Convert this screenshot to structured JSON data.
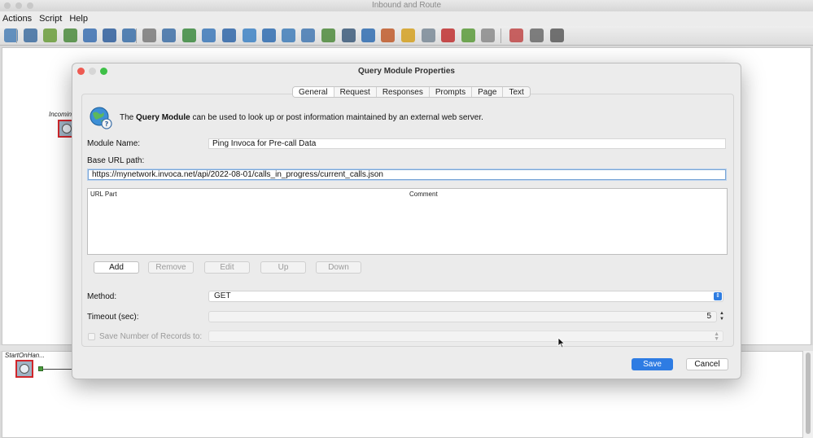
{
  "window": {
    "title": "Inbound and Route"
  },
  "menubar": {
    "items": [
      "Actions",
      "Script",
      "Help"
    ]
  },
  "toolbar": {
    "icons": [
      "script-icon",
      "calculator-grid-icon",
      "edit-check-icon",
      "verify-icon",
      "branch-icon",
      "shuffle-icon",
      "calculator-icon",
      "diamond-icon",
      "user-icon",
      "checklist-icon",
      "globe-icon",
      "database-icon",
      "link-icon",
      "database-query-icon",
      "database-update-icon",
      "table-icon",
      "import-icon",
      "binoculars-icon",
      "screen-icon",
      "users-group-icon",
      "people-icon",
      "agent-icon",
      "tag-icon",
      "download-icon",
      "eraser-icon",
      "person-red-icon",
      "gear-icon",
      "person-gear-icon"
    ]
  },
  "canvas": {
    "incoming_label": "Incomin",
    "start_label": "StartOnHan..."
  },
  "dialog": {
    "title": "Query Module Properties",
    "tabs": [
      "General",
      "Request",
      "Responses",
      "Prompts",
      "Page",
      "Text"
    ],
    "active_tab": "General",
    "info": {
      "prefix": "The ",
      "bold": "Query Module",
      "suffix": " can be used to look up or post information maintained by an external web server."
    },
    "module_name_label": "Module Name:",
    "module_name_value": "Ping Invoca for Pre-call Data",
    "base_url_label": "Base URL path:",
    "base_url_value": "https://mynetwork.invoca.net/api/2022-08-01/calls_in_progress/current_calls.json",
    "table": {
      "columns": [
        "URL Part",
        "Comment"
      ],
      "rows": []
    },
    "buttons": {
      "add": "Add",
      "remove": "Remove",
      "edit": "Edit",
      "up": "Up",
      "down": "Down"
    },
    "method_label": "Method:",
    "method_value": "GET",
    "timeout_label": "Timeout (sec):",
    "timeout_value": "5",
    "save_records_label": "Save Number of Records to:",
    "save_label": "Save",
    "cancel_label": "Cancel"
  }
}
